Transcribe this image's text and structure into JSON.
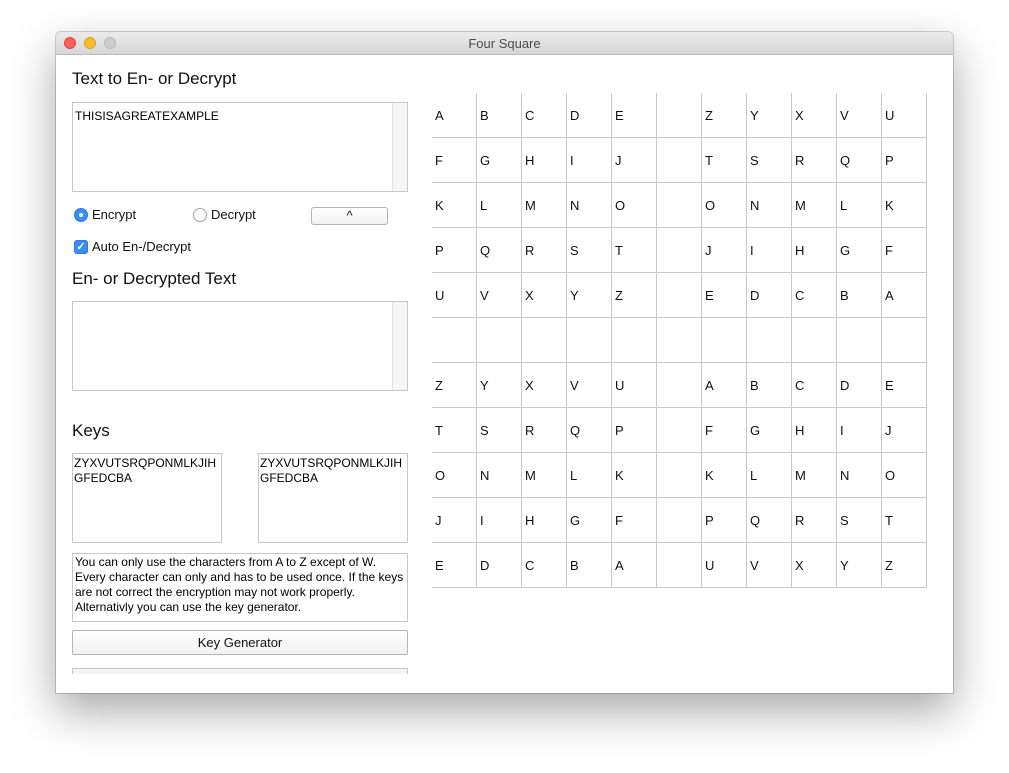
{
  "window": {
    "title": "Four Square"
  },
  "input_section": {
    "heading": "Text to En- or Decrypt",
    "value": "THISISAGREATEXAMPLE"
  },
  "mode": {
    "encrypt_label": "Encrypt",
    "decrypt_label": "Decrypt",
    "selected": "Encrypt",
    "swap_button_label": "^",
    "auto_label": "Auto En-/Decrypt",
    "auto_checked": true
  },
  "output_section": {
    "heading": "En- or Decrypted Text",
    "value": ""
  },
  "keys": {
    "heading": "Keys",
    "key1": "ZYXVUTSRQPONMLKJIHGFEDCBA",
    "key2": "ZYXVUTSRQPONMLKJIHGFEDCBA",
    "info": "You can only use the characters from A to Z except of W. Every character can only and has to be used once. If the keys are not correct the encryption may not work properly. Alternativly you can use the key generator.",
    "generator_button": "Key Generator"
  },
  "grid": {
    "rows": [
      [
        "A",
        "B",
        "C",
        "D",
        "E",
        "",
        "Z",
        "Y",
        "X",
        "V",
        "U"
      ],
      [
        "F",
        "G",
        "H",
        "I",
        "J",
        "",
        "T",
        "S",
        "R",
        "Q",
        "P"
      ],
      [
        "K",
        "L",
        "M",
        "N",
        "O",
        "",
        "O",
        "N",
        "M",
        "L",
        "K"
      ],
      [
        "P",
        "Q",
        "R",
        "S",
        "T",
        "",
        "J",
        "I",
        "H",
        "G",
        "F"
      ],
      [
        "U",
        "V",
        "X",
        "Y",
        "Z",
        "",
        "E",
        "D",
        "C",
        "B",
        "A"
      ],
      [
        "",
        "",
        "",
        "",
        "",
        "",
        "",
        "",
        "",
        "",
        ""
      ],
      [
        "Z",
        "Y",
        "X",
        "V",
        "U",
        "",
        "A",
        "B",
        "C",
        "D",
        "E"
      ],
      [
        "T",
        "S",
        "R",
        "Q",
        "P",
        "",
        "F",
        "G",
        "H",
        "I",
        "J"
      ],
      [
        "O",
        "N",
        "M",
        "L",
        "K",
        "",
        "K",
        "L",
        "M",
        "N",
        "O"
      ],
      [
        "J",
        "I",
        "H",
        "G",
        "F",
        "",
        "P",
        "Q",
        "R",
        "S",
        "T"
      ],
      [
        "E",
        "D",
        "C",
        "B",
        "A",
        "",
        "U",
        "V",
        "X",
        "Y",
        "Z"
      ]
    ]
  }
}
